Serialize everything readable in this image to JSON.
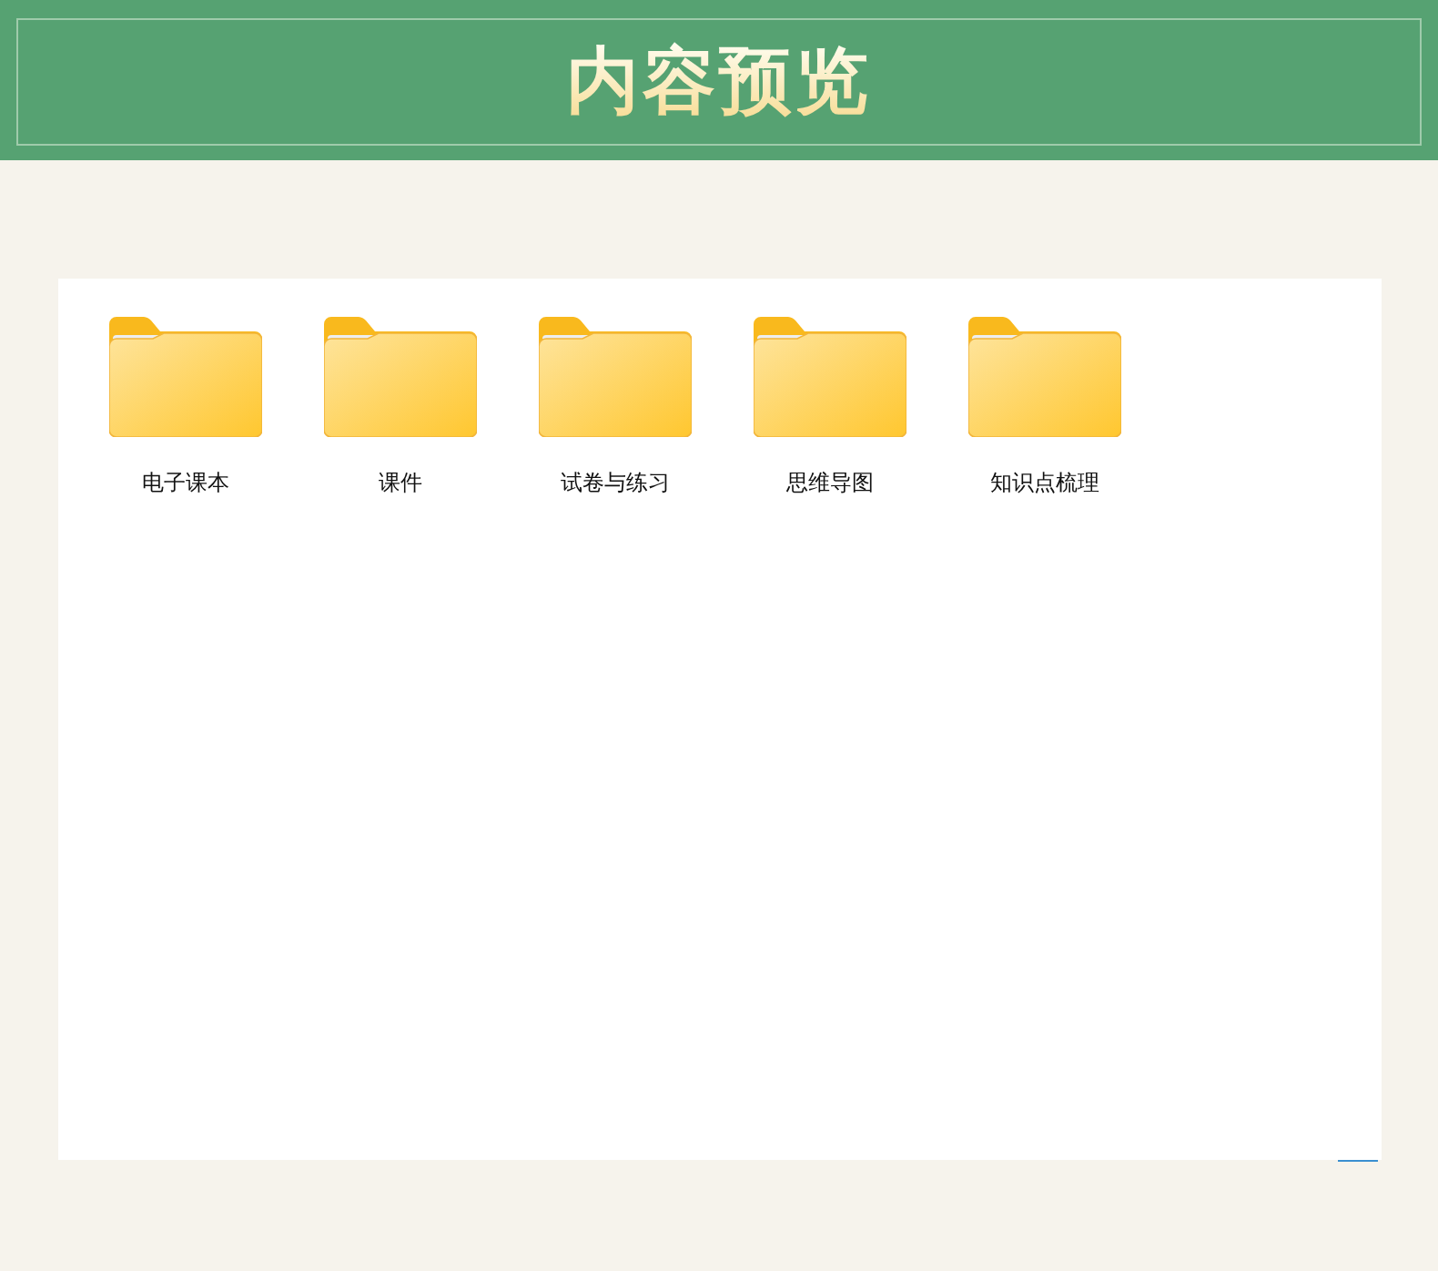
{
  "header": {
    "title": "内容预览"
  },
  "folders": [
    {
      "name": "电子课本"
    },
    {
      "name": "课件"
    },
    {
      "name": "试卷与练习"
    },
    {
      "name": "思维导图"
    },
    {
      "name": "知识点梳理"
    }
  ]
}
